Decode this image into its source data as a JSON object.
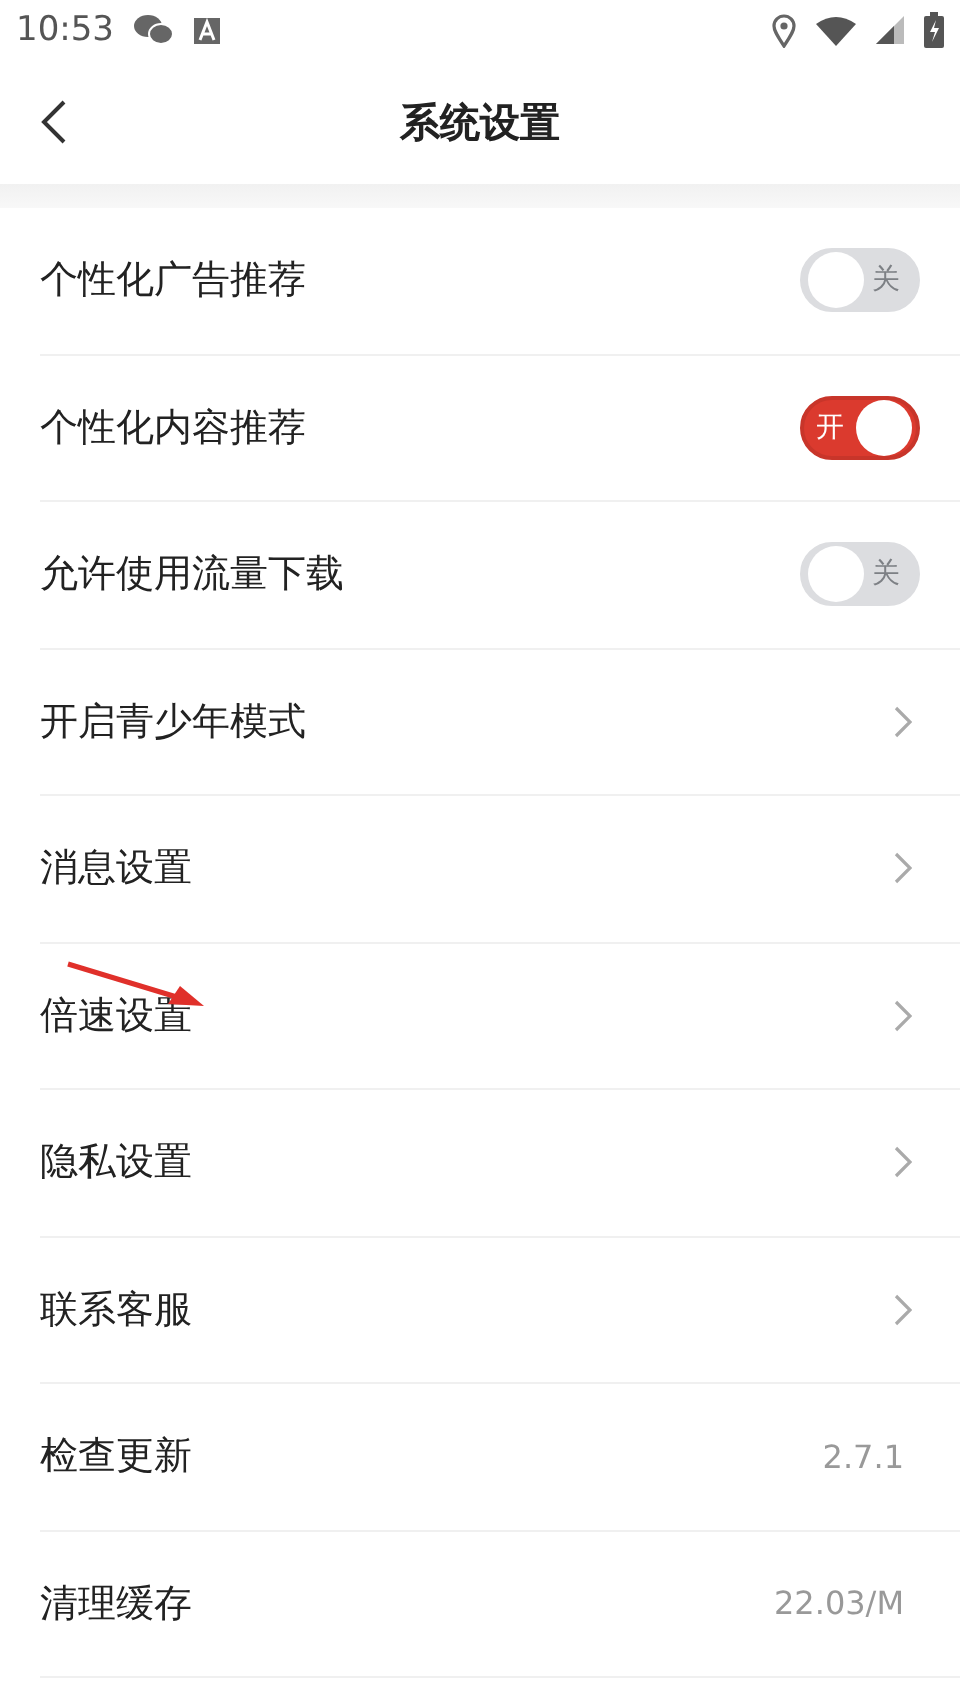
{
  "status_bar": {
    "time": "10:53"
  },
  "header": {
    "title": "系统设置"
  },
  "settings": [
    {
      "kind": "toggle",
      "label": "个性化广告推荐",
      "on": false,
      "text": "关"
    },
    {
      "kind": "toggle",
      "label": "个性化内容推荐",
      "on": true,
      "text": "开"
    },
    {
      "kind": "toggle",
      "label": "允许使用流量下载",
      "on": false,
      "text": "关"
    },
    {
      "kind": "link",
      "label": "开启青少年模式"
    },
    {
      "kind": "link",
      "label": "消息设置"
    },
    {
      "kind": "link",
      "label": "倍速设置"
    },
    {
      "kind": "link",
      "label": "隐私设置"
    },
    {
      "kind": "link",
      "label": "联系客服"
    },
    {
      "kind": "value",
      "label": "检查更新",
      "value": "2.7.1"
    },
    {
      "kind": "value",
      "label": "清理缓存",
      "value": "22.03/M"
    }
  ]
}
